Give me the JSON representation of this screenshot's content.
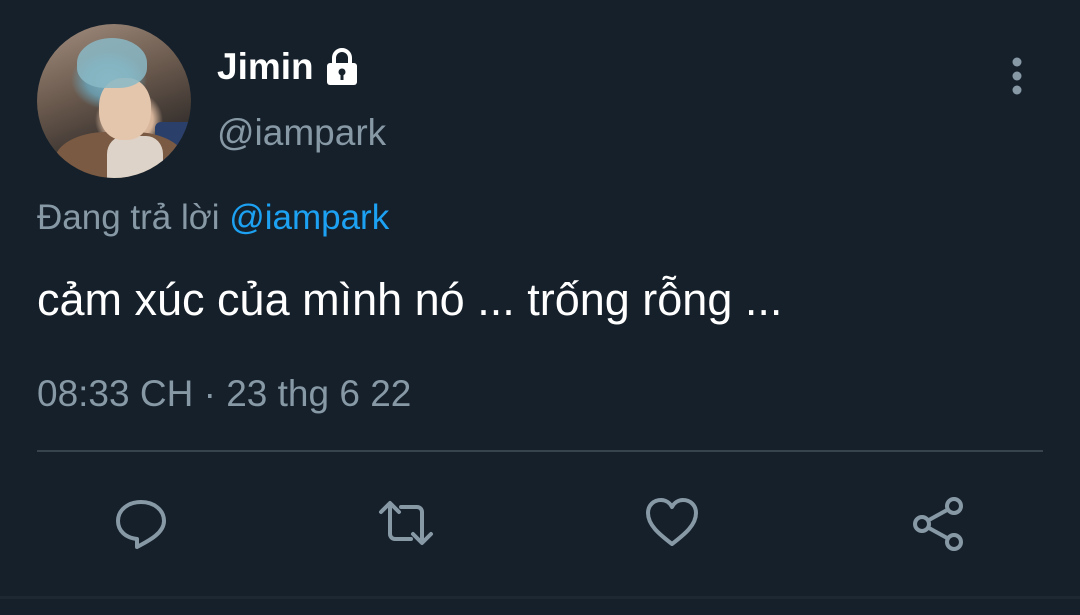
{
  "user": {
    "display_name": "Jimin",
    "handle": "@iampark",
    "protected_icon": "lock-icon",
    "avatar": "profile-photo"
  },
  "reply": {
    "prefix": "Đang trả lời",
    "mention": "@iampark"
  },
  "tweet": {
    "text": "cảm xúc của mình nó ... trống rỗng ...",
    "timestamp": "08:33 CH · 23 thg 6 22"
  },
  "actions": [
    {
      "name": "reply",
      "icon": "comment-icon"
    },
    {
      "name": "retweet",
      "icon": "retweet-icon"
    },
    {
      "name": "like",
      "icon": "heart-icon"
    },
    {
      "name": "share",
      "icon": "share-icon"
    }
  ],
  "menu_icon": "more-vertical-icon",
  "colors": {
    "background": "#15202b",
    "primary_text": "#ffffff",
    "secondary_text": "#8899a6",
    "accent": "#1da1f2",
    "divider": "#38444d"
  }
}
